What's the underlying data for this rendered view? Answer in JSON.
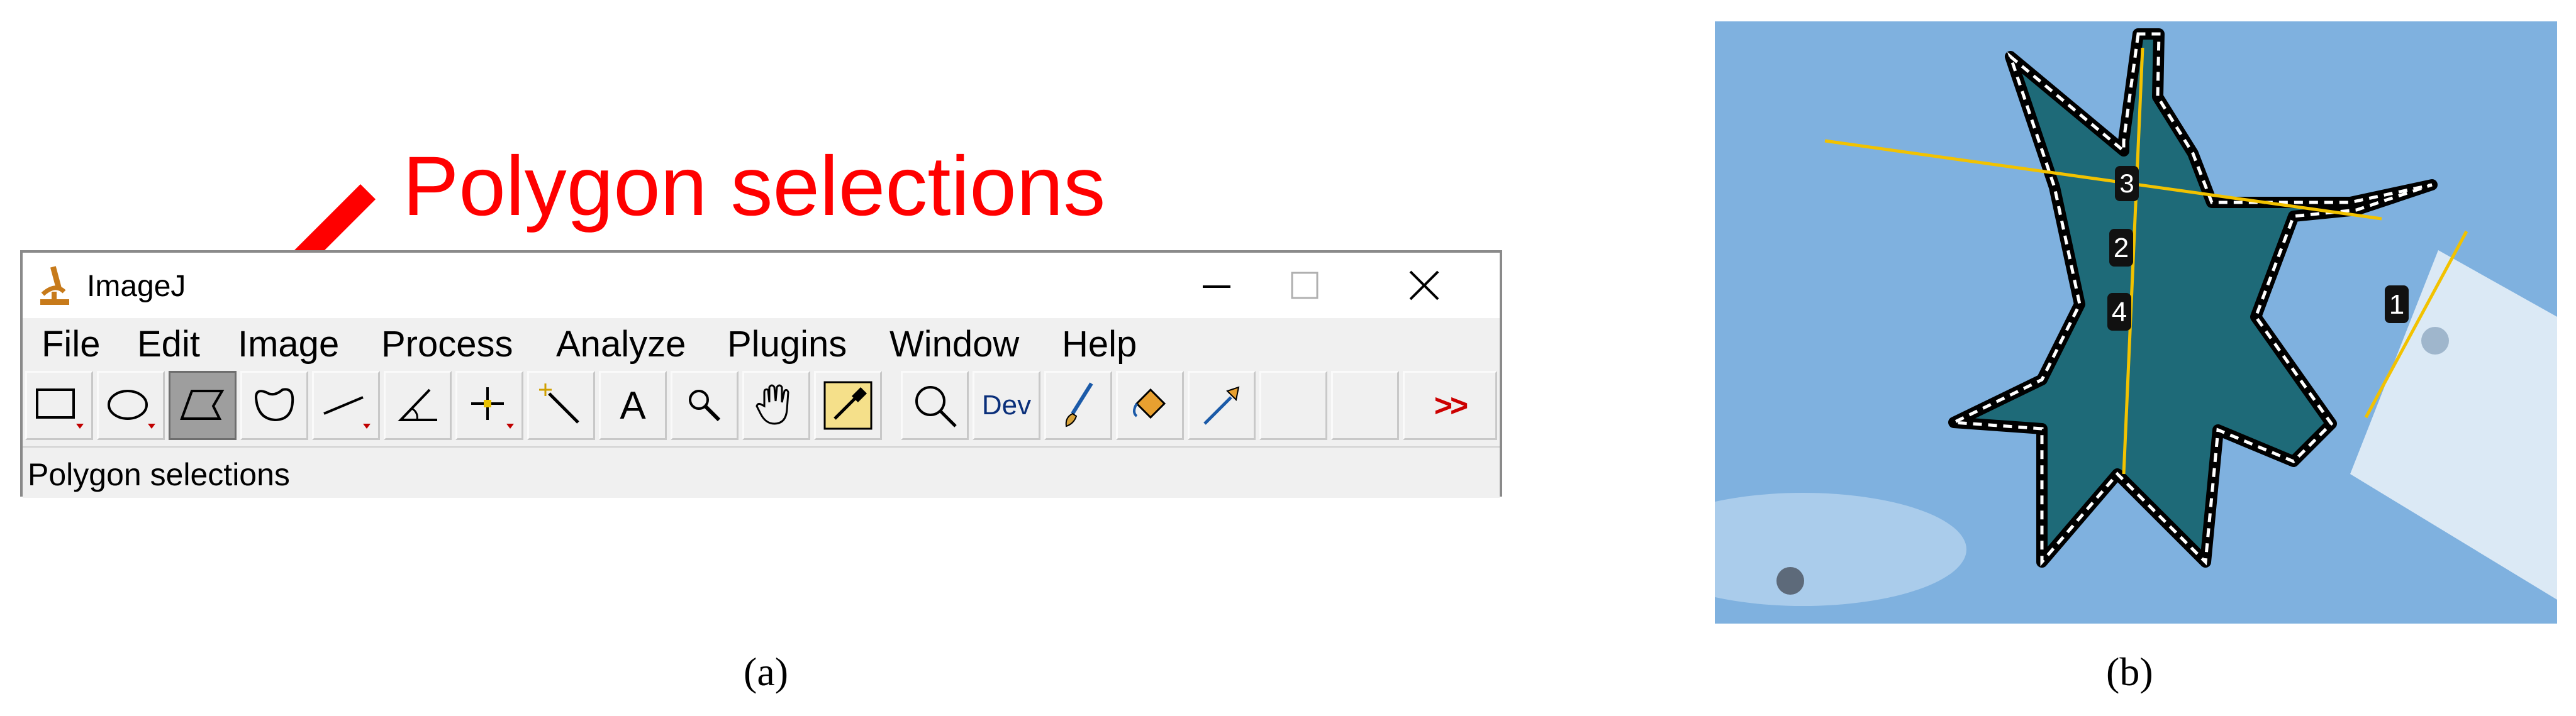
{
  "annotation": {
    "label": "Polygon selections",
    "color": "#ff0000"
  },
  "window": {
    "title": "ImageJ",
    "icon": "microscope-icon",
    "controls": {
      "minimize": "minimize-icon",
      "maximize": "maximize-icon",
      "close": "close-icon"
    }
  },
  "menu": {
    "items": [
      "File",
      "Edit",
      "Image",
      "Process",
      "Analyze",
      "Plugins",
      "Window",
      "Help"
    ]
  },
  "toolbar": {
    "tools": [
      {
        "name": "rectangle-tool",
        "icon": "rectangle-icon",
        "selected": false
      },
      {
        "name": "oval-tool",
        "icon": "oval-icon",
        "selected": false
      },
      {
        "name": "polygon-tool",
        "icon": "polygon-icon",
        "selected": true
      },
      {
        "name": "freehand-tool",
        "icon": "freehand-icon",
        "selected": false
      },
      {
        "name": "line-tool",
        "icon": "line-icon",
        "selected": false
      },
      {
        "name": "angle-tool",
        "icon": "angle-icon",
        "selected": false
      },
      {
        "name": "point-tool",
        "icon": "point-icon",
        "selected": false
      },
      {
        "name": "wand-tool",
        "icon": "wand-icon",
        "selected": false
      },
      {
        "name": "text-tool",
        "icon": "text-icon",
        "label": "A",
        "selected": false
      },
      {
        "name": "magnifying-tool",
        "icon": "magnifier-icon",
        "selected": false
      },
      {
        "name": "scrolling-tool",
        "icon": "hand-icon",
        "selected": false
      },
      {
        "name": "color-picker-tool",
        "icon": "eyedropper-icon",
        "selected": false
      },
      {
        "name": "zoom-tool",
        "icon": "zoom-icon",
        "selected": false
      },
      {
        "name": "developer-menu",
        "icon": "dev-icon",
        "label": "Dev",
        "selected": false
      },
      {
        "name": "brush-tool",
        "icon": "brush-icon",
        "selected": false
      },
      {
        "name": "flood-fill-tool",
        "icon": "bucket-icon",
        "selected": false
      },
      {
        "name": "pipette-tool",
        "icon": "pipette-icon",
        "selected": false
      },
      {
        "name": "empty-slot-1",
        "icon": "",
        "selected": false
      },
      {
        "name": "empty-slot-2",
        "icon": "",
        "selected": false
      },
      {
        "name": "more-tools-button",
        "icon": "more-icon",
        "label": ">>",
        "selected": false
      }
    ]
  },
  "status": {
    "text": "Polygon selections"
  },
  "captions": {
    "a": "(a)",
    "b": "(b)"
  },
  "leaf_figure": {
    "background_color": "#7fb1df",
    "leaf_color": "#1e6a78",
    "measurement_line_color": "#f2c200",
    "measurement_labels": [
      "1",
      "2",
      "3",
      "4"
    ]
  }
}
